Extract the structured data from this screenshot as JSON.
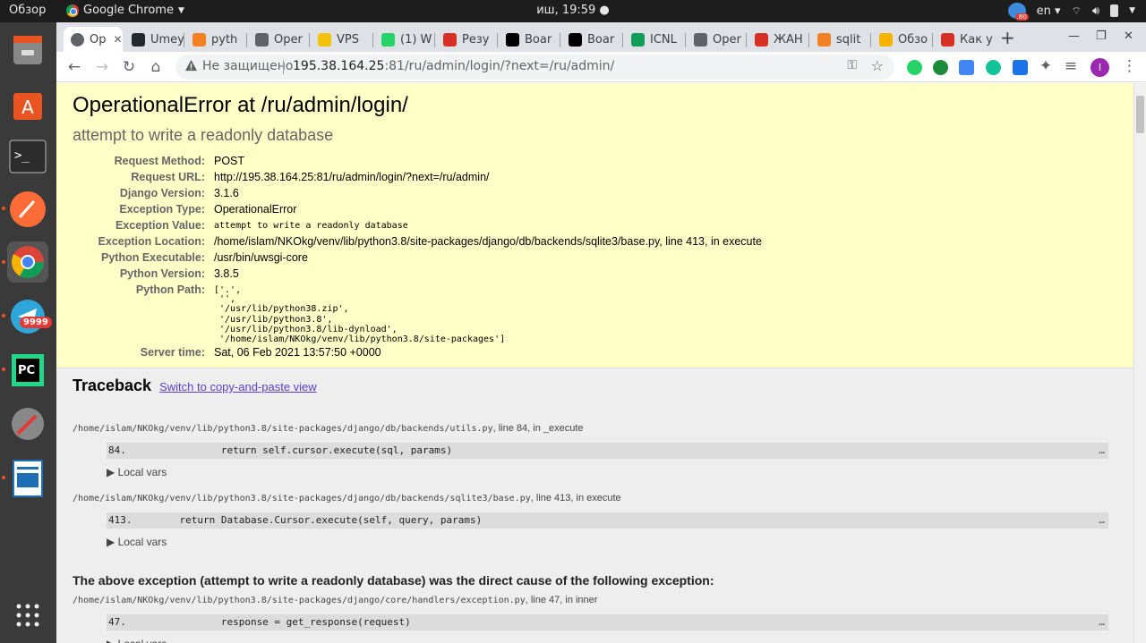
{
  "system": {
    "activities": "Обзор",
    "app_name": "Google Chrome",
    "clock": "иш, 19:59",
    "lang": "en"
  },
  "dock": {
    "telegram_badge": "9999"
  },
  "tabs": [
    {
      "label": "Op",
      "fav_color": "#5f6368",
      "active": true
    },
    {
      "label": "Umey",
      "fav_color": "#24292e"
    },
    {
      "label": "pyth",
      "fav_color": "#f48024"
    },
    {
      "label": "Oper",
      "fav_color": "#5f6368"
    },
    {
      "label": "VPS",
      "fav_color": "#f4c20d"
    },
    {
      "label": "(1) W",
      "fav_color": "#25d366"
    },
    {
      "label": "Резу",
      "fav_color": "#d93025"
    },
    {
      "label": "Boar",
      "fav_color": "#000000"
    },
    {
      "label": "Boar",
      "fav_color": "#000000"
    },
    {
      "label": "ICNL",
      "fav_color": "#0f9d58"
    },
    {
      "label": "Oper",
      "fav_color": "#5f6368"
    },
    {
      "label": "ЖАН",
      "fav_color": "#d93025"
    },
    {
      "label": "sqlit",
      "fav_color": "#f48024"
    },
    {
      "label": "Обзо",
      "fav_color": "#f4b400"
    },
    {
      "label": "Как у",
      "fav_color": "#d93025"
    }
  ],
  "omnibox": {
    "insecure": "Не защищено",
    "host": "195.38.164.25",
    "rest": ":81/ru/admin/login/?next=/ru/admin/"
  },
  "avatar_letter": "I",
  "summary": {
    "title": "OperationalError at /ru/admin/login/",
    "subtitle": "attempt to write a readonly database",
    "rows": [
      {
        "key": "Request Method:",
        "value": "POST"
      },
      {
        "key": "Request URL:",
        "value": "http://195.38.164.25:81/ru/admin/login/?next=/ru/admin/"
      },
      {
        "key": "Django Version:",
        "value": "3.1.6"
      },
      {
        "key": "Exception Type:",
        "value": "OperationalError"
      },
      {
        "key": "Exception Value:",
        "value": "attempt to write a readonly database"
      },
      {
        "key": "Exception Location:",
        "value": "/home/islam/NKOkg/venv/lib/python3.8/site-packages/django/db/backends/sqlite3/base.py, line 413, in execute"
      },
      {
        "key": "Python Executable:",
        "value": "/usr/bin/uwsgi-core"
      },
      {
        "key": "Python Version:",
        "value": "3.8.5"
      },
      {
        "key": "Python Path:",
        "value": "['.',"
      },
      {
        "key": "Server time:",
        "value": "Sat, 06 Feb 2021 13:57:50 +0000"
      }
    ],
    "python_path_lines": [
      " '',",
      " '/usr/lib/python38.zip',",
      " '/usr/lib/python3.8',",
      " '/usr/lib/python3.8/lib-dynload',",
      " '/home/islam/NKOkg/venv/lib/python3.8/site-packages']"
    ]
  },
  "traceback": {
    "title": "Traceback",
    "switch_link": "Switch to copy-and-paste view",
    "local_vars": "▶ Local vars",
    "frames": [
      {
        "file": "/home/islam/NKOkg/venv/lib/python3.8/site-packages/django/db/backends/utils.py",
        "loc": ", line 84, in _execute",
        "code": "84.                return self.cursor.execute(sql, params)"
      },
      {
        "file": "/home/islam/NKOkg/venv/lib/python3.8/site-packages/django/db/backends/sqlite3/base.py",
        "loc": ", line 413, in execute",
        "code": "413.        return Database.Cursor.execute(self, query, params)"
      },
      {
        "file": "/home/islam/NKOkg/venv/lib/python3.8/site-packages/django/core/handlers/exception.py",
        "loc": ", line 47, in inner",
        "code": "47.                response = get_response(request)"
      }
    ],
    "cause": "The above exception (attempt to write a readonly database) was the direct cause of the following exception:",
    "dots": "…"
  }
}
